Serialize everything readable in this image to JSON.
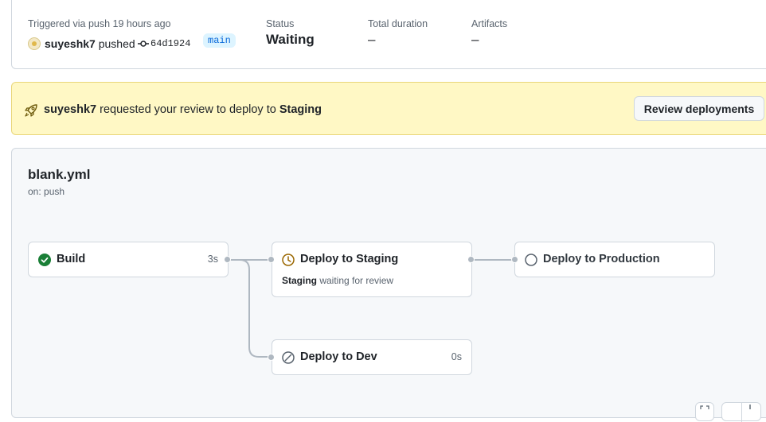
{
  "summary": {
    "triggered_label": "Triggered via push 19 hours ago",
    "actor": "suyeshk7",
    "pushed_word": "pushed",
    "commit": "64d1924",
    "branch": "main",
    "status_label": "Status",
    "status_value": "Waiting",
    "duration_label": "Total duration",
    "duration_value": "–",
    "artifacts_label": "Artifacts",
    "artifacts_value": "–"
  },
  "banner": {
    "actor": "suyeshk7",
    "text": "requested your review to deploy to",
    "environment": "Staging",
    "button": "Review deployments"
  },
  "workflow": {
    "file": "blank.yml",
    "trigger": "on: push",
    "jobs": [
      {
        "name": "Build",
        "time": "3s",
        "status": "success"
      },
      {
        "name": "Deploy to Staging",
        "status": "waiting",
        "sub_env": "Staging",
        "sub_text": "waiting for review"
      },
      {
        "name": "Deploy to Production",
        "status": "pending"
      },
      {
        "name": "Deploy to Dev",
        "time": "0s",
        "status": "skipped"
      }
    ]
  },
  "colors": {
    "success": "#1a7f37",
    "waiting": "#9a6700",
    "neutral": "#59636e",
    "accent": "#0969da",
    "banner_bg": "#fff8c5"
  }
}
